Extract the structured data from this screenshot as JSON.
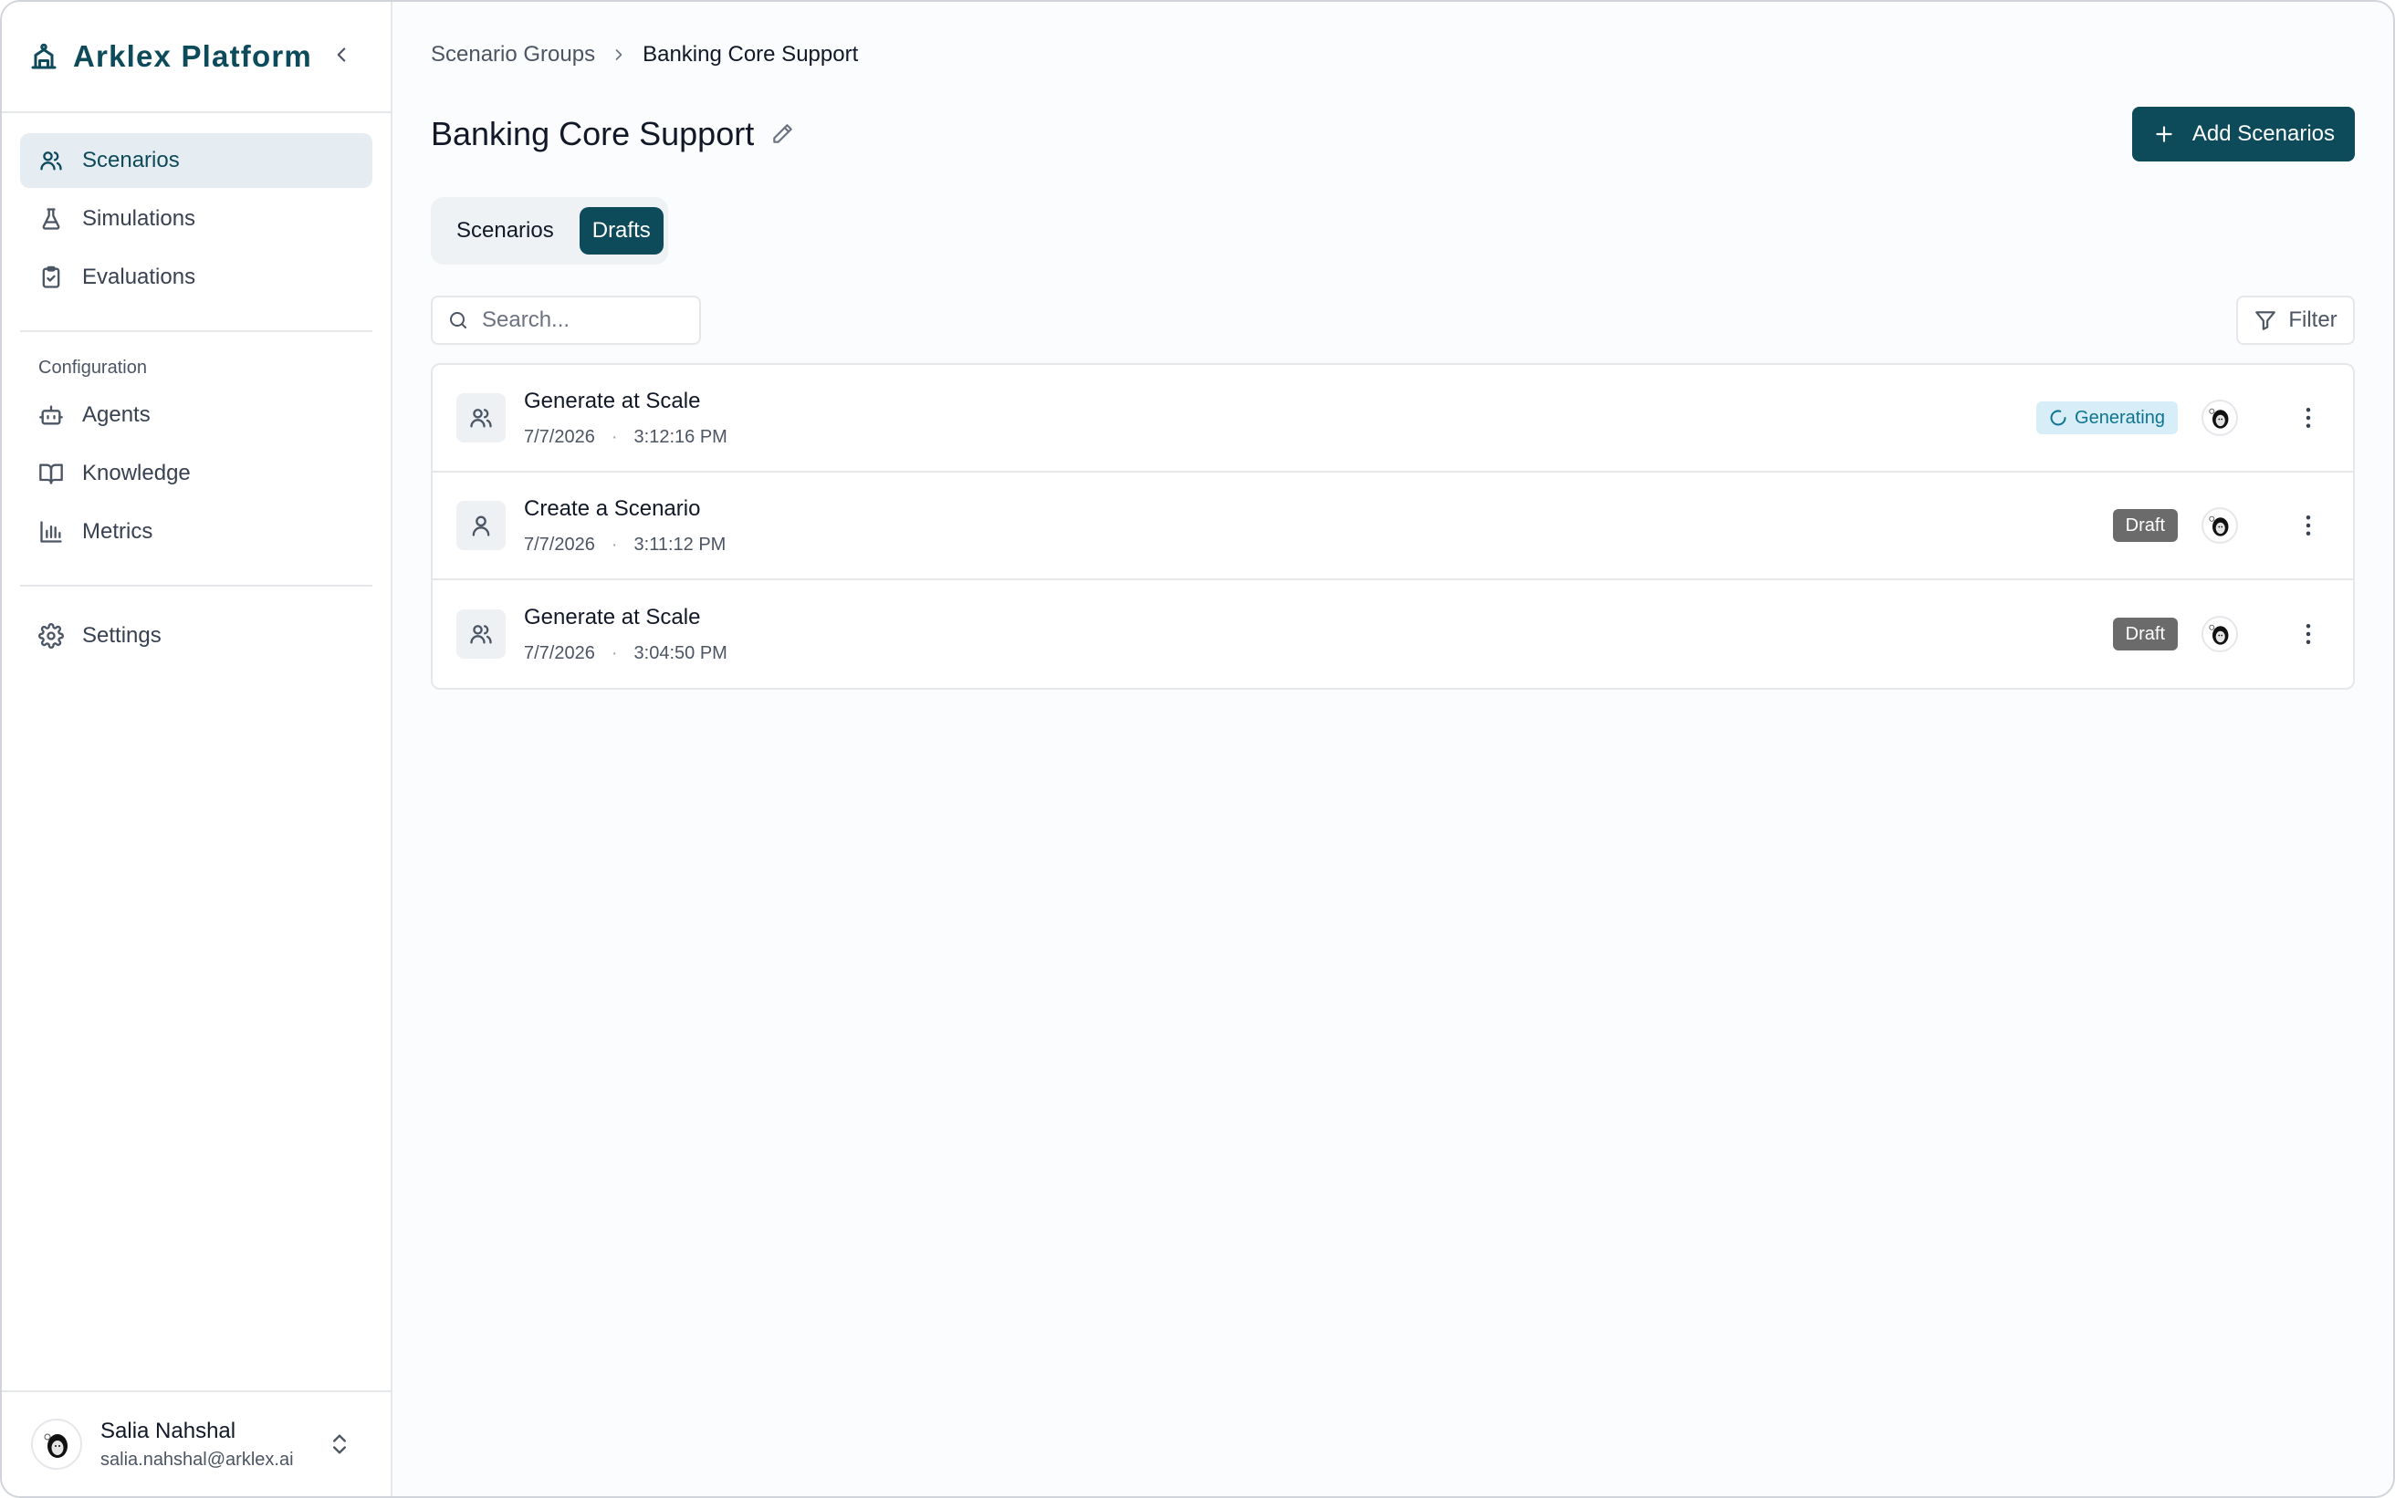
{
  "app": {
    "name": "Arklex Platform"
  },
  "sidebar": {
    "items": [
      {
        "label": "Scenarios",
        "icon": "users-icon",
        "active": true
      },
      {
        "label": "Simulations",
        "icon": "flask-icon"
      },
      {
        "label": "Evaluations",
        "icon": "clipboard-check-icon"
      }
    ],
    "config_label": "Configuration",
    "config_items": [
      {
        "label": "Agents",
        "icon": "bot-icon"
      },
      {
        "label": "Knowledge",
        "icon": "book-icon"
      },
      {
        "label": "Metrics",
        "icon": "bar-chart-icon"
      }
    ],
    "settings_label": "Settings"
  },
  "user": {
    "name": "Salia Nahshal",
    "email": "salia.nahshal@arklex.ai"
  },
  "breadcrumb": {
    "parent": "Scenario Groups",
    "current": "Banking Core Support"
  },
  "page": {
    "title": "Banking Core Support",
    "add_button": "Add Scenarios"
  },
  "tabs": {
    "scenarios": "Scenarios",
    "drafts": "Drafts",
    "active": "drafts"
  },
  "search": {
    "placeholder": "Search...",
    "value": ""
  },
  "filter": {
    "label": "Filter"
  },
  "rows": [
    {
      "title": "Generate at Scale",
      "date": "7/7/2026",
      "time": "3:12:16 PM",
      "status": "Generating",
      "icon": "users-icon"
    },
    {
      "title": "Create a Scenario",
      "date": "7/7/2026",
      "time": "3:11:12 PM",
      "status": "Draft",
      "icon": "user-icon"
    },
    {
      "title": "Generate at Scale",
      "date": "7/7/2026",
      "time": "3:04:50 PM",
      "status": "Draft",
      "icon": "users-icon"
    }
  ],
  "colors": {
    "brand": "#0d4a5a",
    "generating_bg": "#d7eef8",
    "draft_bg": "#6b6b6b"
  }
}
